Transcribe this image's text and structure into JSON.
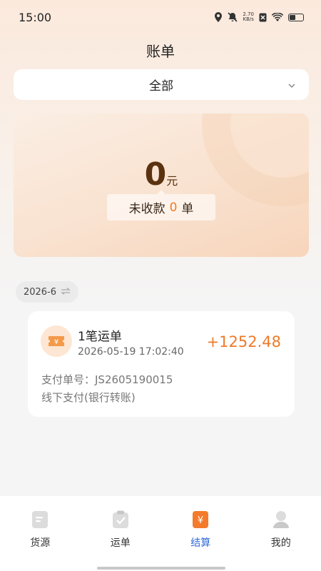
{
  "status_bar": {
    "time": "15:00",
    "net_speed_value": "2.70",
    "net_speed_unit": "KB/s",
    "icons": [
      "location-icon",
      "mute-icon",
      "sim-off-icon",
      "wifi-icon",
      "battery-icon"
    ]
  },
  "header": {
    "title": "账单"
  },
  "filter": {
    "selected": "全部"
  },
  "summary": {
    "amount": "0",
    "unit": "元",
    "pending_prefix": "未收款",
    "pending_count": "0",
    "pending_suffix": "单"
  },
  "month_chip": {
    "label": "2026-6"
  },
  "bills": [
    {
      "title": "1笔运单",
      "time": "2026-05-19 17:02:40",
      "amount": "+1252.48",
      "pay_no": "支付单号：JS2605190015",
      "method": "线下支付(银行转账)"
    }
  ],
  "tabs": [
    {
      "label": "货源",
      "icon": "document-icon"
    },
    {
      "label": "运单",
      "icon": "clipboard-check-icon"
    },
    {
      "label": "结算",
      "icon": "yuan-ticket-icon",
      "active": true
    },
    {
      "label": "我的",
      "icon": "user-icon"
    }
  ],
  "colors": {
    "accent": "#f07a22",
    "active_tab": "#2f6ad8"
  }
}
